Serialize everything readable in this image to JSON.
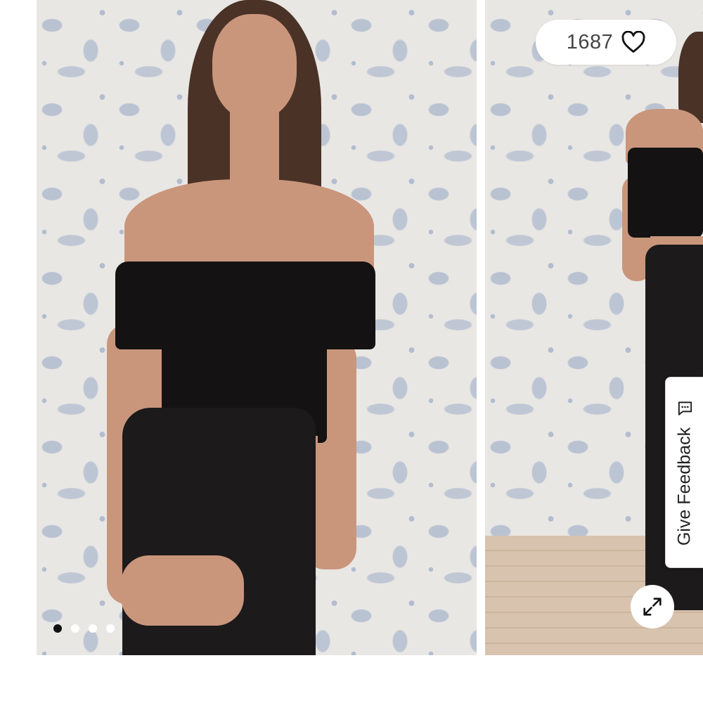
{
  "product_gallery": {
    "likes": {
      "count": "1687",
      "icon": "heart-outline-icon"
    },
    "slides": [
      {
        "description": "off-shoulder black velvet top with black velvet skirt, front view"
      },
      {
        "description": "black velvet top and skirt, full-length view"
      }
    ],
    "pagination": {
      "total": 4,
      "active_index": 0
    },
    "expand_icon": "expand-arrows-icon"
  },
  "feedback_tab": {
    "label": "Give Feedback",
    "icon": "chat-bubble-icon"
  }
}
